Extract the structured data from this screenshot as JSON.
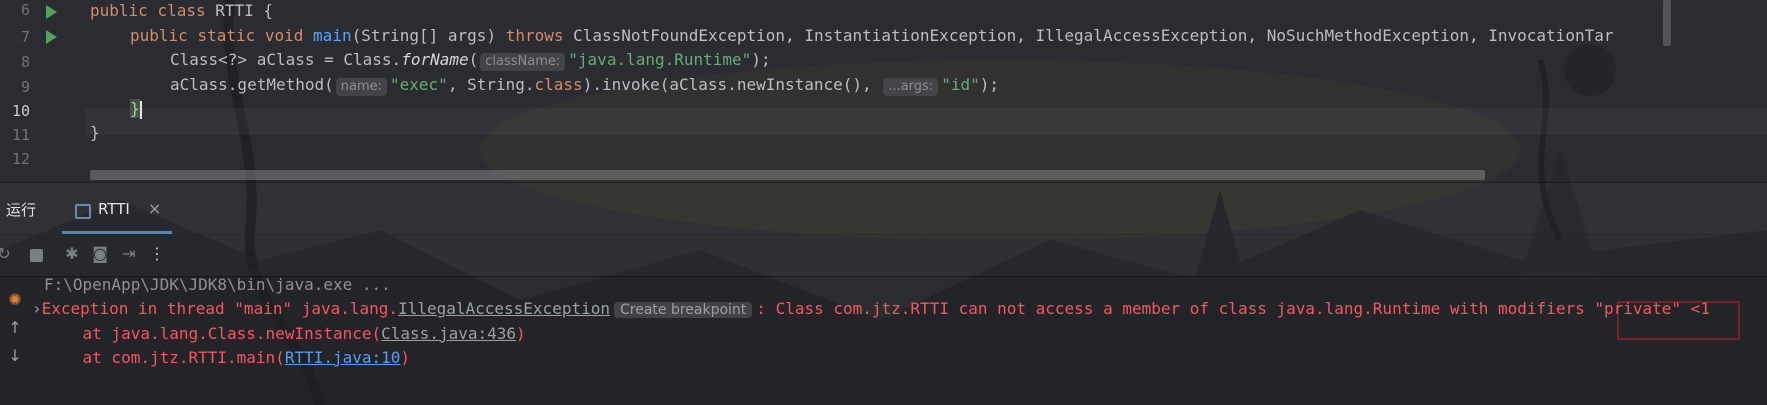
{
  "editor": {
    "line_numbers": [
      "6",
      "7",
      "8",
      "9",
      "10",
      "11",
      "12"
    ],
    "current_line": "10",
    "lines": {
      "l6": {
        "kw1": "public",
        "kw2": "class",
        "name": " RTTI ",
        "brace": "{"
      },
      "l7": {
        "kw1": "public",
        "kw2": "static",
        "kw3": "void",
        "fn": "main",
        "rest": "(String[] args) ",
        "throws": "throws",
        "exceptions": " ClassNotFoundException, InstantiationException, IllegalAccessException, NoSuchMethodException, InvocationTar"
      },
      "l8": {
        "pre": "Class<?> aClass = Class.",
        "method": "forName",
        "open": "(",
        "hint": "className:",
        "str": "\"java.lang.Runtime\"",
        "close": ");"
      },
      "l9": {
        "pre": "aClass.getMethod(",
        "hint1": "name:",
        "str1": "\"exec\"",
        "mid1": ", String.",
        "kw": "class",
        "mid2": ").invoke(aClass.newInstance(), ",
        "hint2": "...args:",
        "str2": "\"id\"",
        "close": ");"
      },
      "l10": {
        "brace": "}"
      },
      "l11": {
        "brace": "}"
      }
    }
  },
  "tool_window": {
    "title": "运行",
    "tab_label": "RTTI",
    "tab_close": "×"
  },
  "toolbar": {
    "icons": [
      "rerun-icon",
      "stop-icon",
      "debug-icon",
      "screenshot-icon",
      "exit-icon",
      "more-icon"
    ]
  },
  "console": {
    "command": "F:\\OpenApp\\JDK\\JDK8\\bin\\java.exe ...",
    "error_prefix": "Exception in thread \"main\" java.lang.",
    "error_class": "IllegalAccessException",
    "breakpoint_label": "Create breakpoint",
    "error_message": ": Class com.jtz.RTTI can not access a member of class java.lang.Runtime with modifiers \"private\" <1",
    "trace1_prefix": "    at java.lang.Class.newInstance(",
    "trace1_link": "Class.java:436",
    "trace1_suffix": ")",
    "trace2_prefix": "    at com.jtz.RTTI.main(",
    "trace2_link": "RTTI.java:10",
    "trace2_suffix": ")"
  },
  "colors": {
    "keyword": "#cf8e6d",
    "function": "#57a8f5",
    "string": "#6aab73",
    "error": "#f75464",
    "highlight_box": "#e0262c"
  }
}
